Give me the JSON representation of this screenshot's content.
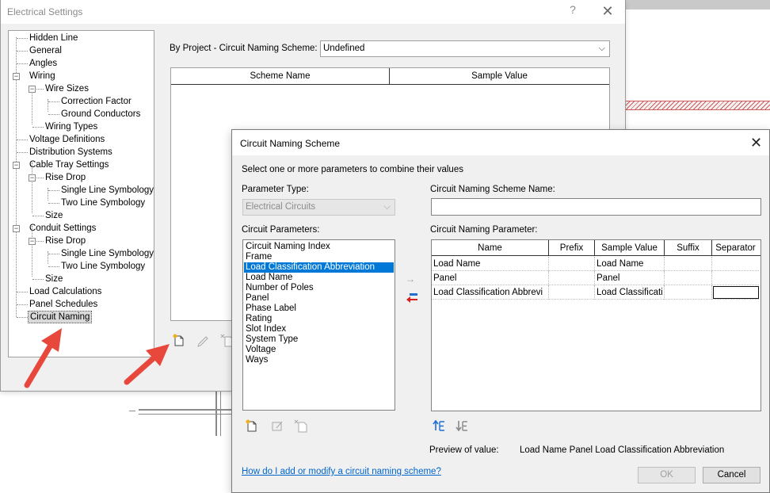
{
  "electrical_settings": {
    "title": "Electrical Settings",
    "help_glyph": "?",
    "close_glyph": "✕",
    "tree": [
      {
        "label": "Hidden Line"
      },
      {
        "label": "General"
      },
      {
        "label": "Angles"
      },
      {
        "label": "Wiring"
      },
      {
        "label": "Wire Sizes"
      },
      {
        "label": "Correction Factor"
      },
      {
        "label": "Ground Conductors"
      },
      {
        "label": "Wiring Types"
      },
      {
        "label": "Voltage Definitions"
      },
      {
        "label": "Distribution Systems"
      },
      {
        "label": "Cable Tray Settings"
      },
      {
        "label": "Rise Drop"
      },
      {
        "label": "Single Line Symbology"
      },
      {
        "label": "Two Line Symbology"
      },
      {
        "label": "Size"
      },
      {
        "label": "Conduit Settings"
      },
      {
        "label": "Rise Drop"
      },
      {
        "label": "Single Line Symbology"
      },
      {
        "label": "Two Line Symbology"
      },
      {
        "label": "Size"
      },
      {
        "label": "Load Calculations"
      },
      {
        "label": "Panel Schedules"
      },
      {
        "label": "Circuit Naming"
      }
    ],
    "selected_tree_item": "Circuit Naming",
    "scheme_label": "By Project - Circuit Naming Scheme:",
    "scheme_value": "Undefined",
    "table_headers": [
      "Scheme Name",
      "Sample Value"
    ]
  },
  "circuit_naming_scheme": {
    "title": "Circuit Naming Scheme",
    "close_glyph": "✕",
    "instructions": "Select one or more parameters to combine their values",
    "parameter_type_label": "Parameter Type:",
    "parameter_type_value": "Electrical Circuits",
    "circuit_parameters_label": "Circuit Parameters:",
    "circuit_parameters": [
      "Circuit Naming Index",
      "Frame",
      "Load Classification Abbreviation",
      "Load Name",
      "Number of Poles",
      "Panel",
      "Phase Label",
      "Rating",
      "Slot Index",
      "System Type",
      "Voltage",
      "Ways"
    ],
    "selected_parameter": "Load Classification Abbreviation",
    "scheme_name_label": "Circuit Naming Scheme Name:",
    "scheme_name_value": "",
    "naming_parameter_label": "Circuit Naming Parameter:",
    "naming_headers": [
      "Name",
      "Prefix",
      "Sample Value",
      "Suffix",
      "Separator"
    ],
    "naming_rows": [
      {
        "name": "Load Name",
        "prefix": "",
        "sample": "Load Name",
        "suffix": "",
        "separator": ""
      },
      {
        "name": "Panel",
        "prefix": "",
        "sample": "Panel",
        "suffix": "",
        "separator": ""
      },
      {
        "name": "Load Classification Abbrevi",
        "prefix": "",
        "sample": "Load Classificati",
        "suffix": "",
        "separator": ""
      }
    ],
    "preview_label": "Preview of value:",
    "preview_value": "Load Name Panel Load Classification Abbreviation",
    "help_link": "How do I add or modify a circuit naming scheme?",
    "ok_label": "OK",
    "cancel_label": "Cancel"
  },
  "colors": {
    "selection": "#0078d7",
    "link": "#0066cc",
    "annotation_arrow": "#e8483c",
    "remove_arrow": "#d81e1e",
    "move_icon": "#1f6fd1"
  }
}
